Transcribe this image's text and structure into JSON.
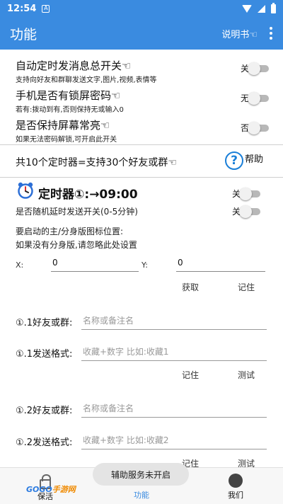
{
  "status": {
    "time": "12:54",
    "notif": "A"
  },
  "appbar": {
    "title": "功能",
    "help": "说明书☜"
  },
  "options": [
    {
      "main": "自动定时发消息总开关☜",
      "sub": "支持向好友和群聊发送文字,图片,视频,表情等",
      "state": "关"
    },
    {
      "main": "手机是否有锁屏密码☜",
      "sub": "若有:拨动到有,否则保持无或输入0",
      "state": "无"
    },
    {
      "main": "是否保持屏幕常亮☜",
      "sub": "如果无法密码解锁,可开启此开关",
      "state": "否"
    }
  ],
  "timers_info": "共10个定时器=支持30个好友或群☜",
  "help_button": {
    "icon": "?",
    "label": "帮助"
  },
  "timer": {
    "title": "定时器①:→09:00",
    "switch_state": "关",
    "random_delay_label": "是否随机延时发送开关(0-5分钟)",
    "random_delay_state": "关"
  },
  "position_hint": [
    "要启动的主/分身版图标位置:",
    "如果没有分身版,请忽略此处设置"
  ],
  "coords": {
    "x_label": "X:",
    "x_value": "0",
    "y_label": "Y:",
    "y_value": "0"
  },
  "coord_buttons": {
    "get": "获取",
    "remember": "记住"
  },
  "slots": [
    {
      "friend_label": "①.1好友或群:",
      "friend_placeholder": "名称或备注名",
      "format_label": "①.1发送格式:",
      "format_placeholder": "收藏+数字 比如:收藏1",
      "remember": "记住",
      "test": "测试"
    },
    {
      "friend_label": "①.2好友或群:",
      "friend_placeholder": "名称或备注名",
      "format_label": "①.2发送格式:",
      "format_placeholder": "收藏+数字 比如:收藏2",
      "remember": "记住",
      "test": "测试"
    }
  ],
  "toast": "辅助服务未开启",
  "nav": {
    "left": "保活",
    "center": "功能",
    "right": "我们"
  },
  "watermark": {
    "go": "GOGO",
    "site": "手游网"
  },
  "colors": {
    "primary": "#3a8be0",
    "help_icon": "#1a7fd8"
  }
}
